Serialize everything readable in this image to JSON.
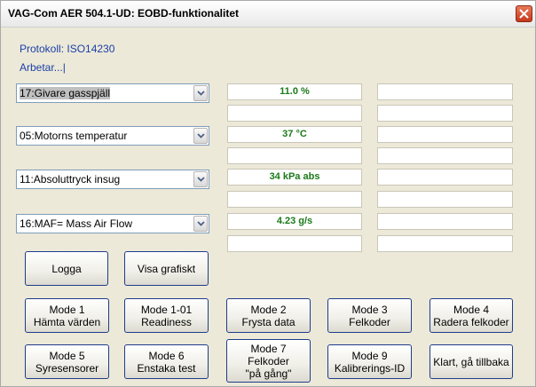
{
  "window": {
    "title": "VAG-Com AER 504.1-UD:  EOBD-funktionalitet"
  },
  "status": {
    "protocol": "Protokoll: ISO14230",
    "working": "Arbetar...|"
  },
  "channels": [
    {
      "selected": "17:Givare gasspjäll",
      "value": "11.0 %",
      "value2": "",
      "extra1": "",
      "extra2": "",
      "highlighted": true
    },
    {
      "selected": "05:Motorns temperatur",
      "value": "37 °C",
      "value2": "",
      "extra1": "",
      "extra2": "",
      "highlighted": false
    },
    {
      "selected": "11:Absoluttryck insug",
      "value": "34 kPa abs",
      "value2": "",
      "extra1": "",
      "extra2": "",
      "highlighted": false
    },
    {
      "selected": "16:MAF= Mass Air Flow",
      "value": "4.23 g/s",
      "value2": "",
      "extra1": "",
      "extra2": "",
      "highlighted": false
    }
  ],
  "buttons": {
    "log": "Logga",
    "graph": "Visa grafiskt",
    "mode1_l1": "Mode 1",
    "mode1_l2": "Hämta värden",
    "mode101_l1": "Mode 1-01",
    "mode101_l2": "Readiness",
    "mode2_l1": "Mode 2",
    "mode2_l2": "Frysta data",
    "mode3_l1": "Mode 3",
    "mode3_l2": "Felkoder",
    "mode4_l1": "Mode 4",
    "mode4_l2": "Radera felkoder",
    "mode5_l1": "Mode 5",
    "mode5_l2": "Syresensorer",
    "mode6_l1": "Mode 6",
    "mode6_l2": "Enstaka test",
    "mode7_l1": "Mode 7",
    "mode7_l2": "Felkoder",
    "mode7_l3": "\"på gång\"",
    "mode9_l1": "Mode 9",
    "mode9_l2": "Kalibrerings-ID",
    "done": "Klart, gå tillbaka"
  },
  "icons": {
    "close": "close-icon",
    "dropdown": "chevron-down-icon"
  },
  "colors": {
    "value_text": "#1a7a1a",
    "status_text": "#1a3fa8",
    "close_button": "#c4381c"
  }
}
